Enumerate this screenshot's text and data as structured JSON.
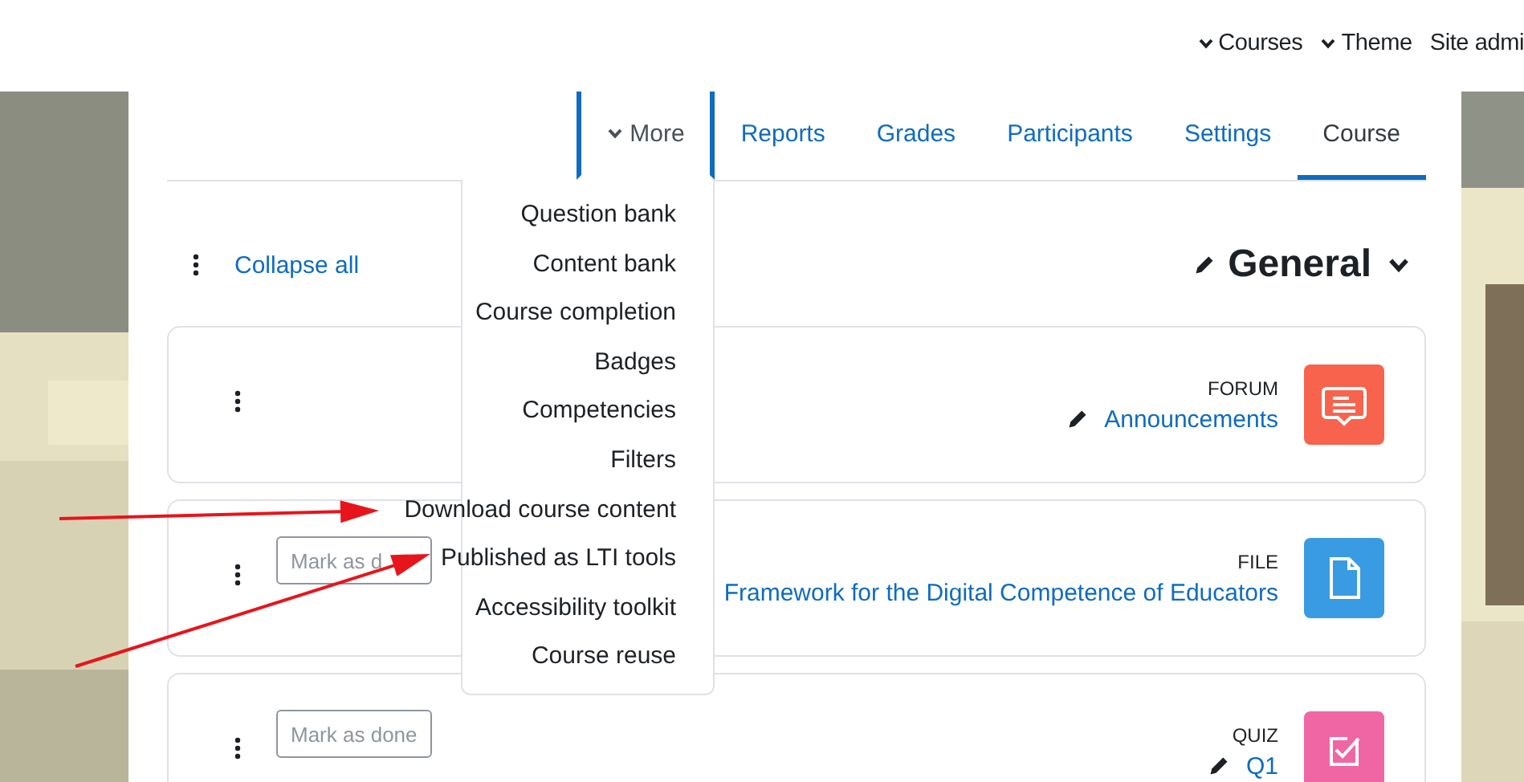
{
  "top_nav": [
    {
      "label": "Courses",
      "dropdown": true
    },
    {
      "label": "Theme",
      "dropdown": true
    },
    {
      "label": "Site admi",
      "dropdown": false
    }
  ],
  "course_tabs": [
    {
      "label": "More",
      "kind": "menu",
      "selected": false
    },
    {
      "label": "Reports",
      "kind": "tab",
      "selected": false
    },
    {
      "label": "Grades",
      "kind": "tab",
      "selected": false
    },
    {
      "label": "Participants",
      "kind": "tab",
      "selected": false
    },
    {
      "label": "Settings",
      "kind": "tab",
      "selected": false
    },
    {
      "label": "Course",
      "kind": "tab",
      "selected": true
    }
  ],
  "more_menu": [
    "Question bank",
    "Content bank",
    "Course completion",
    "Badges",
    "Competencies",
    "Filters",
    "Download course content",
    "Published as LTI tools",
    "Accessibility toolkit",
    "Course reuse"
  ],
  "collapse_link": "Collapse all",
  "section_title": "General",
  "activities": [
    {
      "kind": "forum",
      "type_label": "FORUM",
      "name": "Announcements",
      "editable": true
    },
    {
      "kind": "file",
      "type_label": "FILE",
      "name": "Framework for the Digital Competence of Educators",
      "editable": false,
      "completion_button": "Mark as d"
    },
    {
      "kind": "quiz",
      "type_label": "QUIZ",
      "name": "Q1",
      "editable": true,
      "completion_button": "Mark as done"
    }
  ],
  "annotations": [
    {
      "kind": "arrow"
    },
    {
      "kind": "arrow"
    }
  ]
}
